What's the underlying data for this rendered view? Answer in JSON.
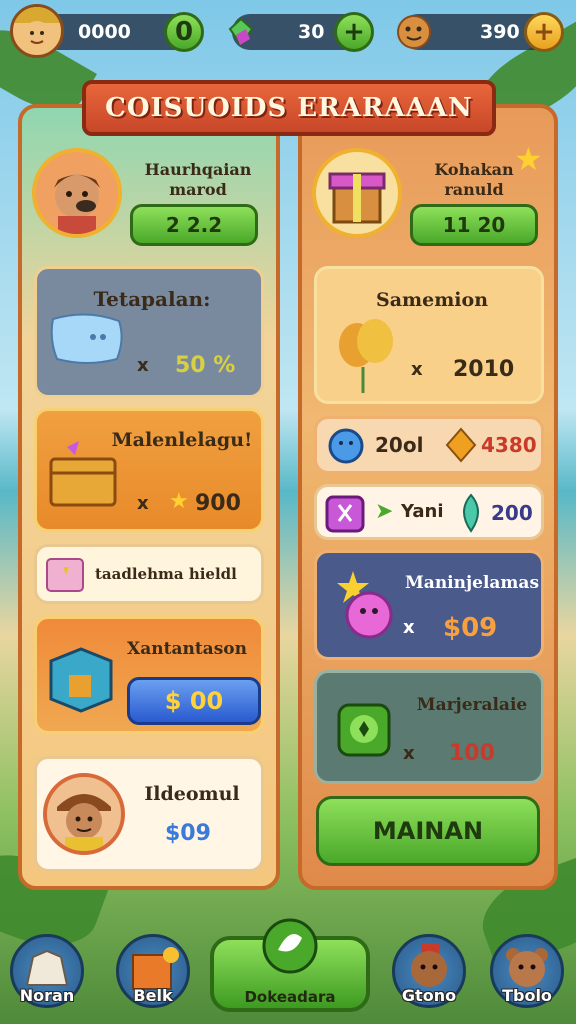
{
  "top_bar": {
    "coins": "0000",
    "gems": "30",
    "cookies": "390",
    "coins_plus": "0",
    "gems_plus": "+",
    "cookies_plus": "+"
  },
  "banner": {
    "title": "COISUOIDS ERARAAAN"
  },
  "left_panel": {
    "header": {
      "label_line1": "Haurhqaian",
      "label_line2": "marod",
      "value": "2 2.2"
    },
    "card1": {
      "title": "Tetapalan:",
      "qty": "50 %"
    },
    "card2": {
      "title": "Malenlelagu!",
      "qty": "900"
    },
    "card3": {
      "title": "taadlehma hieldl"
    },
    "card4": {
      "title": "Xantantason",
      "price": "$ 00"
    },
    "card5": {
      "title": "Ildeomul",
      "price": "$09"
    }
  },
  "right_panel": {
    "header": {
      "label_line1": "Kohakan",
      "label_line2": "ranuld",
      "value": "11 20"
    },
    "card1": {
      "title": "Samemion",
      "qty": "2010"
    },
    "row1": {
      "qty_a": "20ol",
      "qty_b": "4380"
    },
    "row2": {
      "label": "Yani",
      "qty": "200"
    },
    "card2": {
      "title": "Maninjelamas",
      "price": "$09"
    },
    "card3": {
      "title": "Marjeralaie",
      "qty": "100"
    },
    "main_button": "MAINAN"
  },
  "multiplier": "x",
  "bottom_nav": {
    "item1": "Noran",
    "item2": "Belk",
    "center": "Dokeadara",
    "item4": "Gtono",
    "item5": "Tbolo"
  },
  "colors": {
    "accent_green": "#4aa82a",
    "banner_red": "#c8472a",
    "panel_border": "#c56a2a",
    "price_blue": "#2a5ad0"
  }
}
